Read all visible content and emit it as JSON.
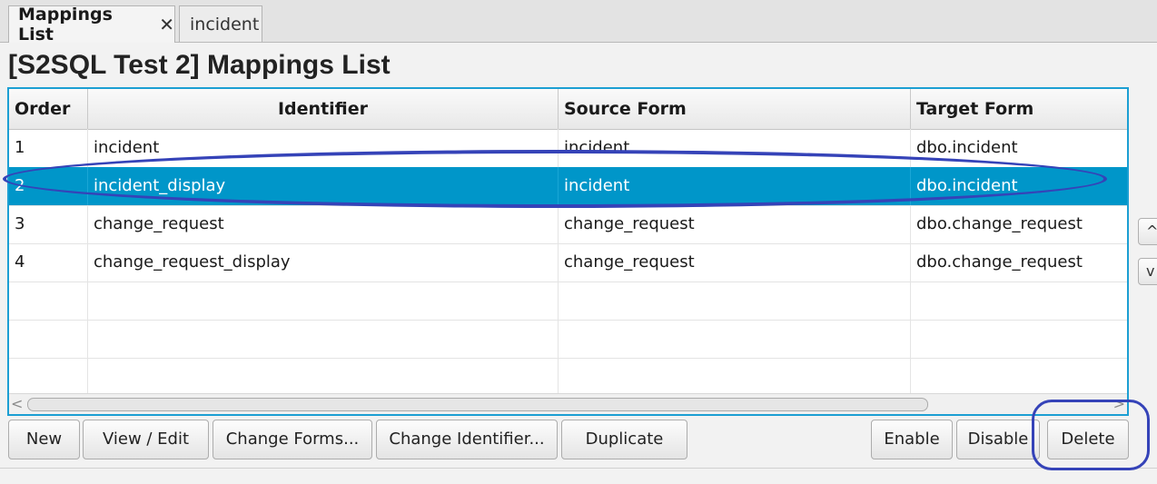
{
  "tabs": [
    {
      "label": "Mappings List",
      "close": "✕"
    },
    {
      "label": "incident"
    }
  ],
  "title": "[S2SQL Test 2] Mappings List",
  "table": {
    "headers": [
      "Order",
      "Identifier",
      "Source Form",
      "Target Form"
    ],
    "rows": [
      [
        "1",
        "incident",
        "incident",
        "dbo.incident"
      ],
      [
        "2",
        "incident_display",
        "incident",
        "dbo.incident"
      ],
      [
        "3",
        "change_request",
        "change_request",
        "dbo.change_request"
      ],
      [
        "4",
        "change_request_display",
        "change_request",
        "dbo.change_request"
      ]
    ],
    "selected_row": 2
  },
  "side_buttons": {
    "up": "^",
    "down": "v"
  },
  "scroll": {
    "left": "<",
    "right": ">"
  },
  "buttons": {
    "new": "New",
    "view_edit": "View / Edit",
    "change_forms": "Change Forms...",
    "change_identifier": "Change Identifier...",
    "duplicate": "Duplicate",
    "enable": "Enable",
    "disable": "Disable",
    "delete": "Delete"
  },
  "colors": {
    "selection": "#0096c9",
    "table_border": "#1c9fd3",
    "annotation": "#3543b8"
  }
}
